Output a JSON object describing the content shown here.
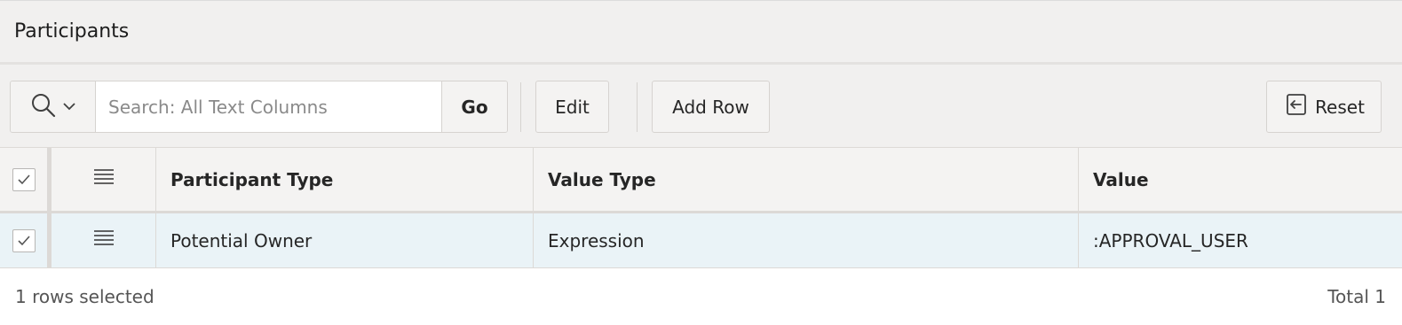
{
  "region": {
    "title": "Participants"
  },
  "toolbar": {
    "search_icon": "search-icon",
    "search_placeholder": "Search: All Text Columns",
    "search_value": "",
    "go_label": "Go",
    "edit_label": "Edit",
    "add_row_label": "Add Row",
    "reset_label": "Reset",
    "reset_icon": "reset-icon"
  },
  "grid": {
    "columns": [
      {
        "label": "Participant Type"
      },
      {
        "label": "Value Type"
      },
      {
        "label": "Value"
      }
    ],
    "rows": [
      {
        "selected": true,
        "cells": [
          "Potential Owner",
          "Expression",
          ":APPROVAL_USER"
        ]
      }
    ],
    "header_checked": true
  },
  "footer": {
    "selection_text": "1 rows selected",
    "total_text": "Total 1"
  },
  "colors": {
    "header_bg": "#f1f0ef",
    "selected_row_bg": "#eaf3f7"
  }
}
